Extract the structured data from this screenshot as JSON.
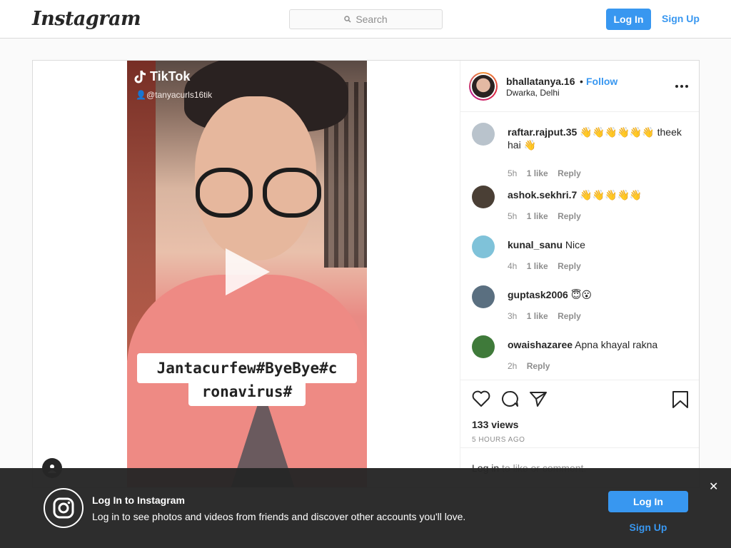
{
  "nav": {
    "logo": "Instagram",
    "search_placeholder": "Search",
    "login_label": "Log In",
    "signup_label": "Sign Up"
  },
  "post": {
    "video": {
      "platform_mark": "TikTok",
      "handle": "@tanyacurls16tik",
      "caption_line1": "Jantacurfew#ByeBye#c",
      "caption_line2": "ronavirus#"
    },
    "header": {
      "username": "bhallatanya.16",
      "separator": "•",
      "follow_label": "Follow",
      "location": "Dwarka, Delhi"
    },
    "comments": [
      {
        "user": "raftar.rajput.35",
        "text": " 👋👋👋👋👋👋 theek hai 👋",
        "age": "5h",
        "likes": "1 like",
        "reply": "Reply",
        "avatar_color": "#b9c3cc"
      },
      {
        "user": "ashok.sekhri.7",
        "text": " 👋👋👋👋👋",
        "age": "5h",
        "likes": "1 like",
        "reply": "Reply",
        "avatar_color": "#4a3f35"
      },
      {
        "user": "kunal_sanu",
        "text": " Nice",
        "age": "4h",
        "likes": "1 like",
        "reply": "Reply",
        "avatar_color": "#7fc2d9"
      },
      {
        "user": "guptask2006",
        "text": " 😇😮",
        "age": "3h",
        "likes": "1 like",
        "reply": "Reply",
        "avatar_color": "#5a6f80"
      },
      {
        "user": "owaishazaree",
        "text": " Apna khayal rakna",
        "age": "2h",
        "likes": "",
        "reply": "Reply",
        "avatar_color": "#3f7a3a"
      }
    ],
    "views": "133 views",
    "timestamp": "5 HOURS AGO",
    "login_link": "Log in",
    "login_prompt": " to like or comment."
  },
  "banner": {
    "title": "Log In to Instagram",
    "subtitle": "Log in to see photos and videos from friends and discover other accounts you'll love.",
    "login_label": "Log In",
    "signup_label": "Sign Up",
    "close_glyph": "✕"
  },
  "colors": {
    "accent": "#3897f0",
    "border": "#dbdbdb",
    "banner_bg": "#262626"
  }
}
